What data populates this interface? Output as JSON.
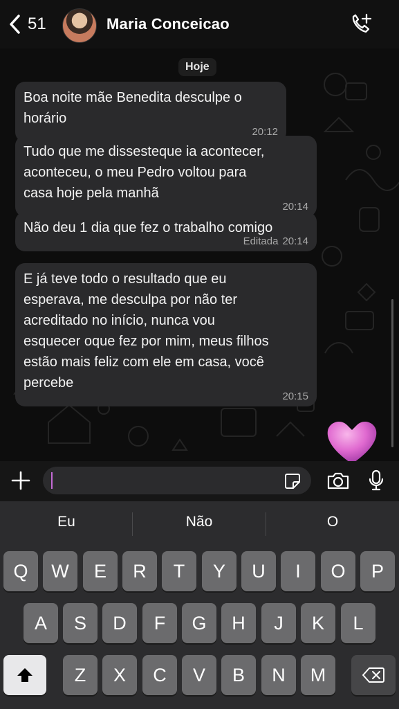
{
  "header": {
    "back_count": "51",
    "contact_name": "Maria Conceicao",
    "icons": {
      "back": "chevron-left-icon",
      "call": "phone-plus-icon"
    }
  },
  "chat": {
    "date_label": "Hoje",
    "messages": [
      {
        "text": "Boa noite mãe Benedita desculpe o\nhorário",
        "time": "20:12",
        "edited": ""
      },
      {
        "text": "Tudo que me dissesteque ia acontecer,\naconteceu, o meu Pedro voltou para\ncasa hoje pela manhã",
        "time": "20:14",
        "edited": ""
      },
      {
        "text": "Não deu 1 dia que fez o trabalho comigo",
        "time": "20:14",
        "edited": "Editada"
      },
      {
        "text": "E já teve todo o resultado que eu\nesperava, me desculpa por não ter\nacreditado no início, nunca vou\nesquecer oque fez por mim, meus filhos\nestão mais feliz com ele em casa, você\npercebe",
        "time": "20:15",
        "edited": ""
      }
    ],
    "reaction": "pink-heart-emoji"
  },
  "input_bar": {
    "value": "",
    "icons": [
      "plus-icon",
      "sticker-icon",
      "camera-icon",
      "microphone-icon"
    ],
    "caret_color": "#c56bd6"
  },
  "keyboard": {
    "suggestions": [
      "Eu",
      "Não",
      "O"
    ],
    "row1": [
      "Q",
      "W",
      "E",
      "R",
      "T",
      "Y",
      "U",
      "I",
      "O",
      "P"
    ],
    "row2": [
      "A",
      "S",
      "D",
      "F",
      "G",
      "H",
      "J",
      "K",
      "L"
    ],
    "row3": [
      "Z",
      "X",
      "C",
      "V",
      "B",
      "N",
      "M"
    ],
    "icons": [
      "shift-icon",
      "backspace-icon"
    ]
  },
  "colors": {
    "bubble": "#2a2a2c",
    "background": "#0d0d0d",
    "key": "#6b6b6d"
  }
}
